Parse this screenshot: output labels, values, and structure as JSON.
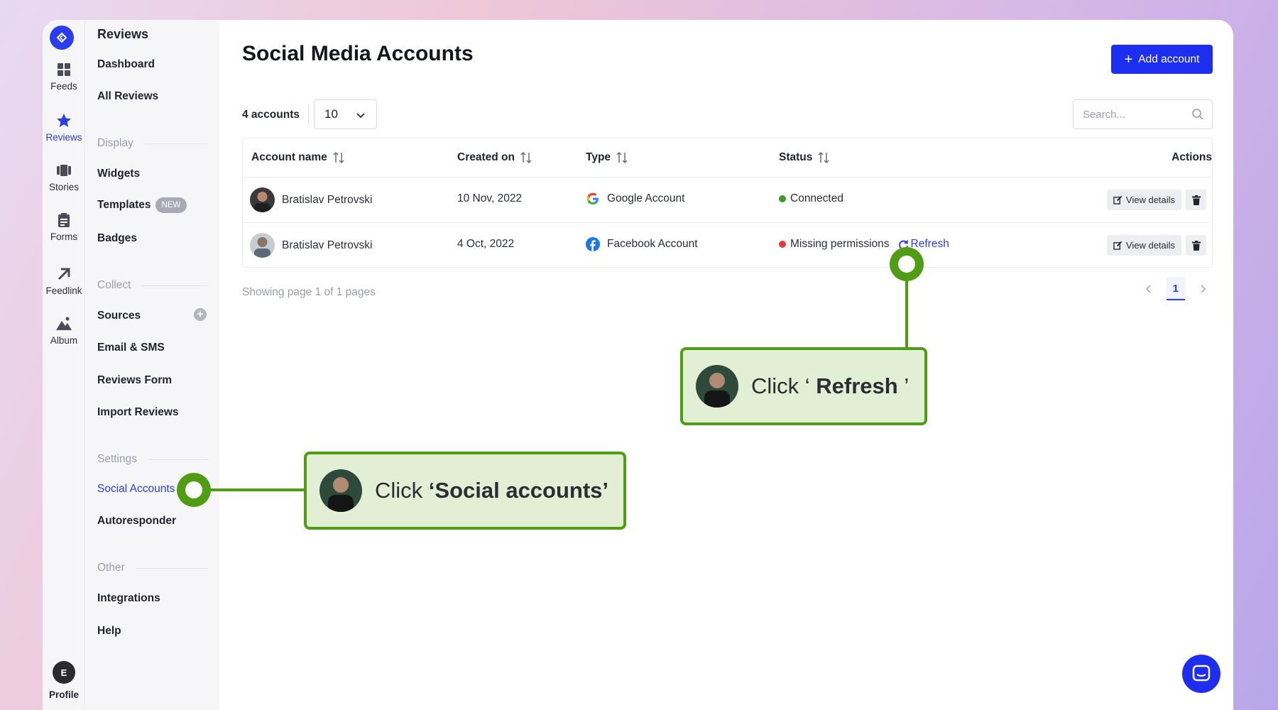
{
  "rail": {
    "items": [
      {
        "label": "Feeds",
        "icon": "grid-icon"
      },
      {
        "label": "Reviews",
        "icon": "star-icon",
        "active": true
      },
      {
        "label": "Stories",
        "icon": "stories-icon"
      },
      {
        "label": "Forms",
        "icon": "clipboard-icon"
      },
      {
        "label": "Feedlink",
        "icon": "arrow-up-right-icon"
      },
      {
        "label": "Album",
        "icon": "mountain-icon"
      }
    ],
    "profile_initial": "E",
    "profile_label": "Profile"
  },
  "sidebar": {
    "title": "Reviews",
    "dashboard": "Dashboard",
    "all_reviews": "All Reviews",
    "section_display": "Display",
    "widgets": "Widgets",
    "templates": "Templates",
    "templates_badge": "NEW",
    "badges": "Badges",
    "section_collect": "Collect",
    "sources": "Sources",
    "email_sms": "Email & SMS",
    "reviews_form": "Reviews Form",
    "import_reviews": "Import Reviews",
    "section_settings": "Settings",
    "social_accounts": "Social Accounts",
    "autoresponder": "Autoresponder",
    "section_other": "Other",
    "integrations": "Integrations",
    "help": "Help"
  },
  "main": {
    "title": "Social Media Accounts",
    "add_button": "Add account",
    "count": "4 accounts",
    "per_page": "10",
    "search_placeholder": "Search...",
    "columns": {
      "account": "Account name",
      "created": "Created on",
      "type": "Type",
      "status": "Status",
      "actions": "Actions"
    },
    "rows": [
      {
        "name": "Bratislav Petrovski",
        "created": "10 Nov, 2022",
        "type": "Google Account",
        "status": "Connected",
        "status_color": "#3d9a26",
        "action": "View details"
      },
      {
        "name": "Bratislav Petrovski",
        "created": "4 Oct, 2022",
        "type": "Facebook Account",
        "status": "Missing permissions",
        "status_color": "#e53935",
        "refresh": "Refresh",
        "action": "View details"
      }
    ],
    "pager_text": "Showing page 1 of 1 pages",
    "current_page": "1"
  },
  "callouts": {
    "refresh": {
      "prefix": "Click ‘ ",
      "bold": "Refresh",
      "suffix": " ’"
    },
    "social": {
      "prefix": "Click ",
      "bold": "‘Social accounts’"
    }
  },
  "colors": {
    "accent": "#1d2ef0",
    "callout_green": "#4e9d12",
    "callout_bg": "#e2efd5"
  }
}
